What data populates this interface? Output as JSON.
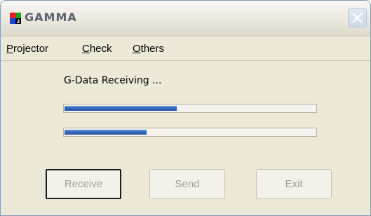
{
  "window": {
    "title": "GAMMA"
  },
  "menu": {
    "items": [
      {
        "mnemonic": "P",
        "rest": "rojector"
      },
      {
        "mnemonic": "C",
        "rest": "heck"
      },
      {
        "mnemonic": "O",
        "rest": "thers"
      }
    ]
  },
  "status_text": "G-Data Receiving ...",
  "progress": [
    {
      "fraction": 0.45
    },
    {
      "fraction": 0.33
    }
  ],
  "buttons": {
    "receive": "Receive",
    "send": "Send",
    "exit": "Exit"
  },
  "colors": {
    "progress_fill": "#2f63b8",
    "disabled_text": "#a39f8e"
  }
}
